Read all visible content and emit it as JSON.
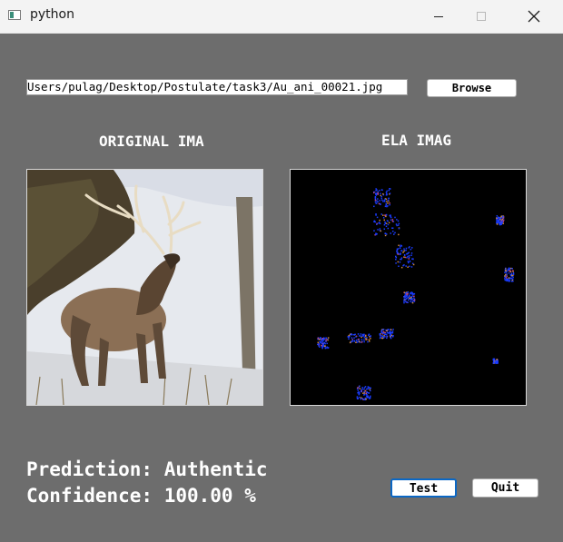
{
  "window": {
    "title": "python"
  },
  "controls": {
    "path_value": "Users/pulag/Desktop/Postulate/task3/Au_ani_00021.jpg",
    "browse_label": "Browse",
    "test_label": "Test",
    "quit_label": "Quit"
  },
  "panels": {
    "original_label": "ORIGINAL IMA",
    "ela_label": "ELA IMAG"
  },
  "result": {
    "prediction": "Prediction: Authentic",
    "confidence": "Confidence: 100.00 %"
  },
  "colors": {
    "background": "#6d6d6d",
    "titlebar": "#f3f3f3",
    "ela_dots": "#1a3cff",
    "focus_border": "#0b67c4"
  },
  "icons": [
    "app-icon",
    "minimize-icon",
    "maximize-icon",
    "close-icon"
  ]
}
